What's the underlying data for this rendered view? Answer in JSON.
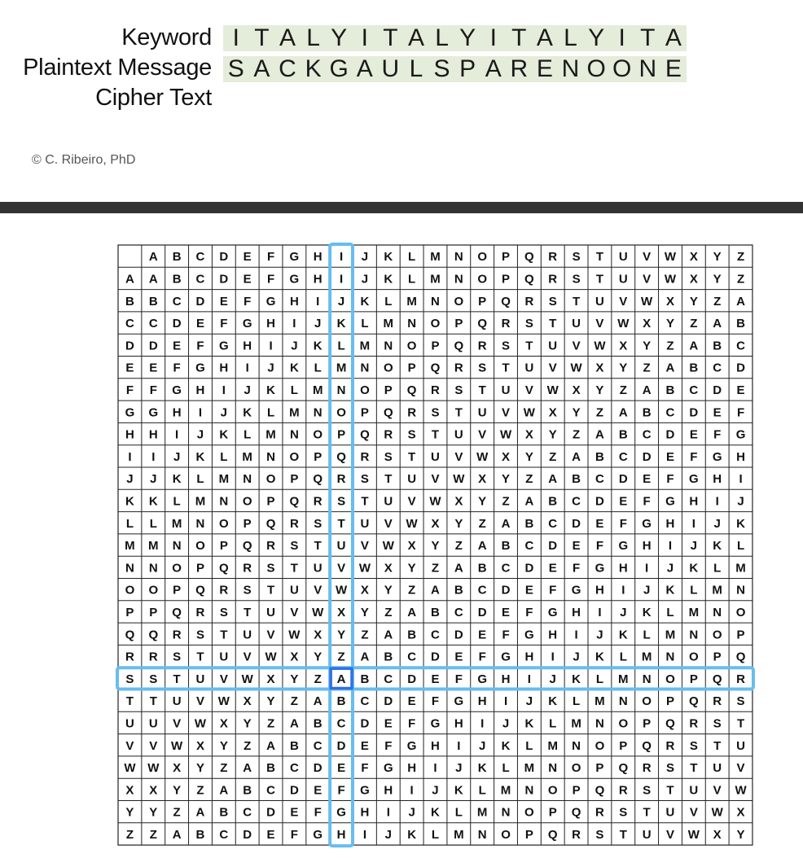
{
  "labels": {
    "keyword": "Keyword",
    "plaintext": "Plaintext Message",
    "ciphertext": "Cipher Text"
  },
  "keyword_letters": [
    "I",
    "T",
    "A",
    "L",
    "Y",
    "I",
    "T",
    "A",
    "L",
    "Y",
    "I",
    "T",
    "A",
    "L",
    "Y",
    "I",
    "T",
    "A"
  ],
  "plaintext_letters": [
    "S",
    "A",
    "C",
    "K",
    "G",
    "A",
    "U",
    "L",
    "S",
    "P",
    "A",
    "R",
    "E",
    "N",
    "O",
    "O",
    "N",
    "E"
  ],
  "ciphertext_letters": [],
  "credit": "© C. Ribeiro, PhD",
  "square": {
    "alphabet": "ABCDEFGHIJKLMNOPQRSTUVWXYZ",
    "highlight_column": "I",
    "highlight_row": "S",
    "highlight_cell": "A",
    "highlight_color": "#66bdf0",
    "cell_highlight_color": "#2f6fe8"
  },
  "colors": {
    "strip_background": "#e4ecda",
    "divider": "#333333"
  }
}
